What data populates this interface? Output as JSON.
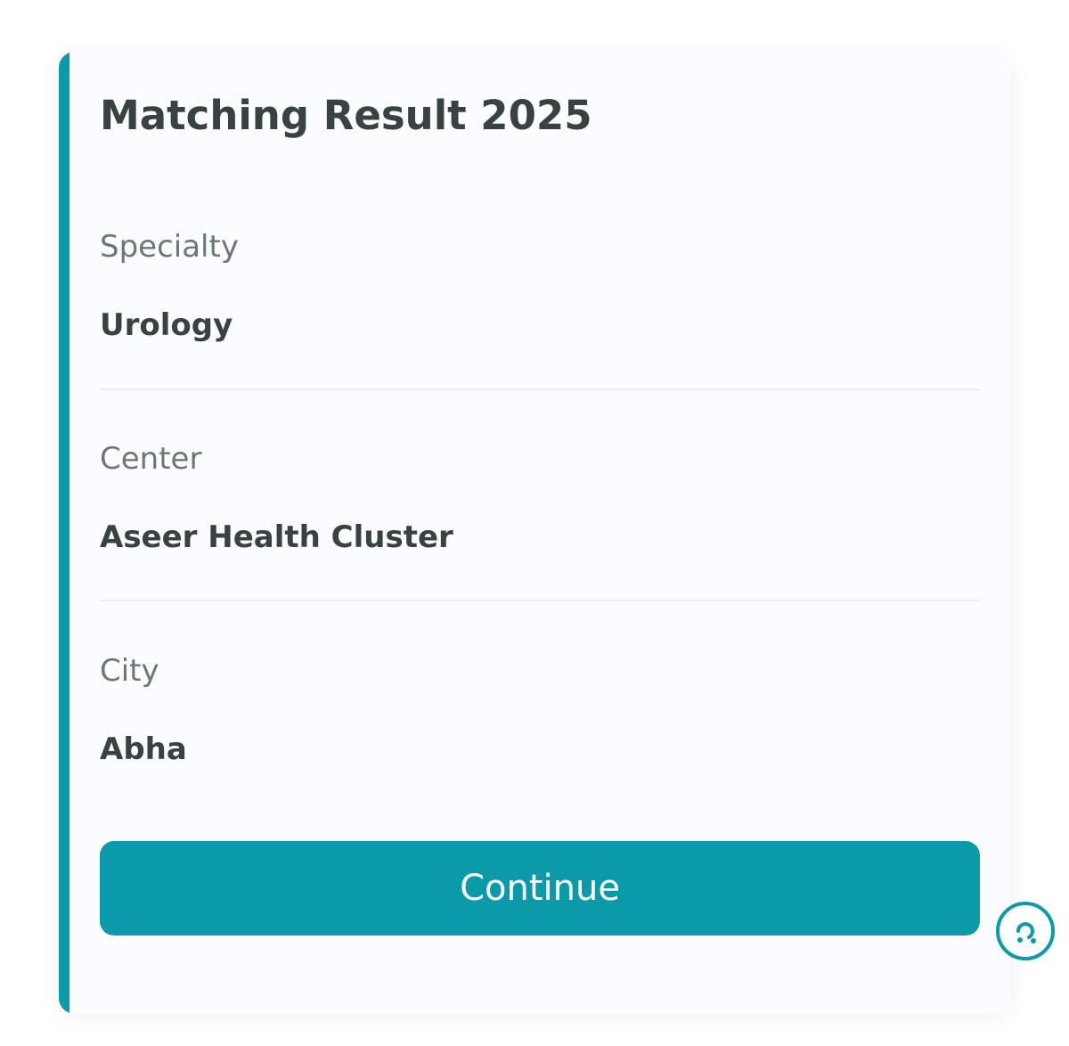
{
  "card": {
    "title": "Matching Result 2025"
  },
  "fields": [
    {
      "label": "Specialty",
      "value": "Urology"
    },
    {
      "label": "Center",
      "value": "Aseer Health Cluster"
    },
    {
      "label": "City",
      "value": "Abha"
    }
  ],
  "actions": {
    "continue_label": "Continue"
  },
  "help": {
    "icon": "help-chat-icon"
  },
  "colors": {
    "accent": "#0b9aa8",
    "title_text": "#3a4143",
    "label_text": "#6d7778"
  }
}
